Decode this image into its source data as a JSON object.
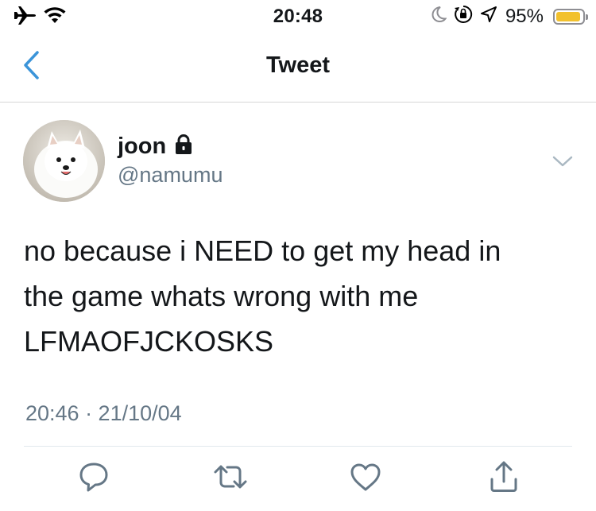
{
  "status_bar": {
    "time": "20:48",
    "battery_percent_label": "95%",
    "battery_level": 0.95,
    "battery_color": "#f2c12e",
    "icons_left": [
      "airplane-icon",
      "wifi-icon"
    ],
    "icons_right": [
      "moon-icon",
      "orientation-lock-icon",
      "location-icon",
      "battery-icon"
    ]
  },
  "nav": {
    "title": "Tweet",
    "back_icon": "chevron-left-icon",
    "accent_color": "#3b94d9"
  },
  "tweet": {
    "author": {
      "name": "joon",
      "handle": "@namumu",
      "verified_lock": "lock-icon"
    },
    "text": "no because i NEED to get my head in\nthe game whats wrong with me\nLFMAOFJCKOSKS",
    "timestamp": "20:46 · 21/10/04"
  },
  "actions": [
    {
      "name": "reply",
      "icon": "reply-icon"
    },
    {
      "name": "retweet",
      "icon": "retweet-icon"
    },
    {
      "name": "like",
      "icon": "heart-icon"
    },
    {
      "name": "share",
      "icon": "share-icon"
    }
  ],
  "colors": {
    "secondary_text": "#657786",
    "action_icon": "#657786",
    "divider": "#e1e8ed"
  }
}
